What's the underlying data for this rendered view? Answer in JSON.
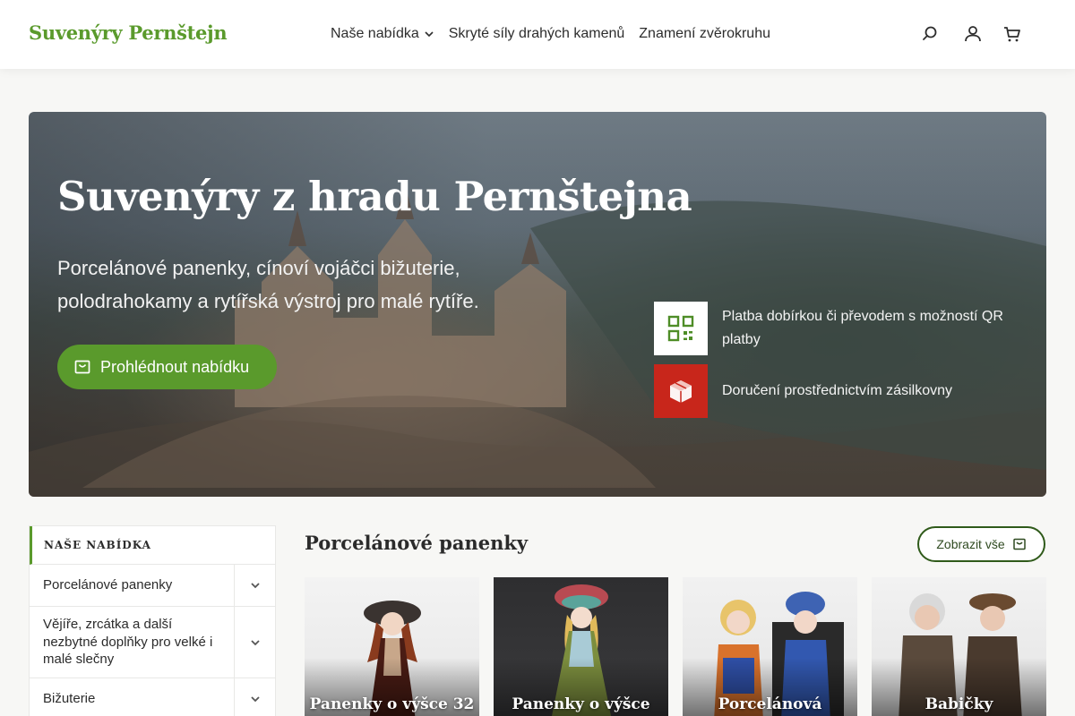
{
  "header": {
    "logo": "Suvenýry Pernštejn",
    "nav": [
      {
        "label": "Naše nabídka",
        "has_dropdown": true
      },
      {
        "label": "Skryté síly drahých kamenů",
        "has_dropdown": false
      },
      {
        "label": "Znamení zvěrokruhu",
        "has_dropdown": false
      }
    ],
    "icons": [
      "search-icon",
      "user-icon",
      "cart-icon"
    ]
  },
  "hero": {
    "title": "Suvenýry z hradu Pernštejna",
    "subtitle": "Porcelánové panenky, cínoví vojáčci bižuterie, polodrahokamy a rytířská výstroj pro malé rytíře.",
    "button_label": "Prohlédnout nabídku",
    "features": [
      {
        "icon": "qr-code-icon",
        "text": "Platba dobírkou či převodem s možností QR platby",
        "color": "#ffffff"
      },
      {
        "icon": "package-icon",
        "text": "Doručení prostřednictvím zásilkovny",
        "color": "#c8261b"
      }
    ]
  },
  "sidebar": {
    "heading": "NAŠE NABÍDKA",
    "items": [
      {
        "label": "Porcelánové panenky"
      },
      {
        "label": "Vějíře, zrcátka a další nezbytné doplňky pro velké i malé slečny"
      },
      {
        "label": "Bižuterie"
      }
    ]
  },
  "products": {
    "title": "Porcelánové panenky",
    "show_all_label": "Zobrazit vše",
    "cards": [
      {
        "caption": "Panenky o výšce 32"
      },
      {
        "caption": "Panenky o výšce"
      },
      {
        "caption": "Porcelánová"
      },
      {
        "caption": "Babičky"
      }
    ]
  },
  "colors": {
    "accent": "#5a9a2c",
    "dark_green": "#2f5a1a",
    "delivery_red": "#c8261b"
  }
}
